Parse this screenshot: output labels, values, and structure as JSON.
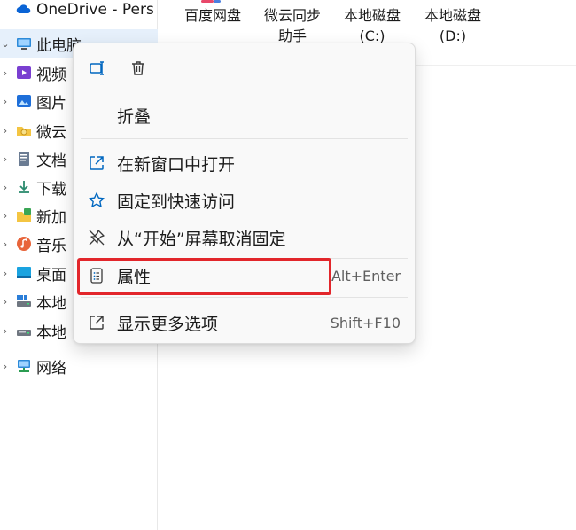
{
  "nav": {
    "items": [
      {
        "label": "OneDrive - Pers",
        "icon": "cloud-icon",
        "chevron": "",
        "selected": false
      },
      {
        "label": "此电脑",
        "icon": "computer-icon",
        "chevron": "⌄",
        "selected": true
      },
      {
        "label": "视频",
        "icon": "video-icon",
        "chevron": "›",
        "selected": false
      },
      {
        "label": "图片",
        "icon": "pictures-icon",
        "chevron": "›",
        "selected": false
      },
      {
        "label": "微云",
        "icon": "weiyun-icon",
        "chevron": "›",
        "selected": false
      },
      {
        "label": "文档",
        "icon": "document-icon",
        "chevron": "›",
        "selected": false
      },
      {
        "label": "下载",
        "icon": "download-icon",
        "chevron": "›",
        "selected": false
      },
      {
        "label": "新加",
        "icon": "new-volume-icon",
        "chevron": "›",
        "selected": false
      },
      {
        "label": "音乐",
        "icon": "music-icon",
        "chevron": "›",
        "selected": false
      },
      {
        "label": "桌面",
        "icon": "desktop-icon",
        "chevron": "›",
        "selected": false
      },
      {
        "label": "本地",
        "icon": "drive-icon",
        "chevron": "›",
        "selected": false
      },
      {
        "label": "本地",
        "icon": "drive-icon",
        "chevron": "›",
        "selected": false
      },
      {
        "label": "网络",
        "icon": "network-icon",
        "chevron": "›",
        "selected": false
      }
    ]
  },
  "tiles": [
    {
      "line1": "百度网盘",
      "line2": ""
    },
    {
      "line1": "微云同步",
      "line2": "助手"
    },
    {
      "line1": "本地磁盘",
      "line2": "(C:)"
    },
    {
      "line1": "本地磁盘",
      "line2": "(D:)"
    }
  ],
  "menu": {
    "quick_actions": [
      {
        "name": "rename-icon"
      },
      {
        "name": "delete-icon"
      }
    ],
    "items": [
      {
        "label": "折叠",
        "icon": "",
        "shortcut": ""
      },
      {
        "label": "在新窗口中打开",
        "icon": "open-new-window-icon",
        "shortcut": ""
      },
      {
        "label": "固定到快速访问",
        "icon": "star-icon",
        "shortcut": ""
      },
      {
        "label": "从“开始”屏幕取消固定",
        "icon": "unpin-icon",
        "shortcut": ""
      },
      {
        "label": "属性",
        "icon": "properties-icon",
        "shortcut": "Alt+Enter"
      },
      {
        "label": "显示更多选项",
        "icon": "more-options-icon",
        "shortcut": "Shift+F10"
      }
    ]
  },
  "colors": {
    "highlight_border": "#e2262b",
    "accent": "#0067c0",
    "selected_bg": "#e6f0fb"
  }
}
